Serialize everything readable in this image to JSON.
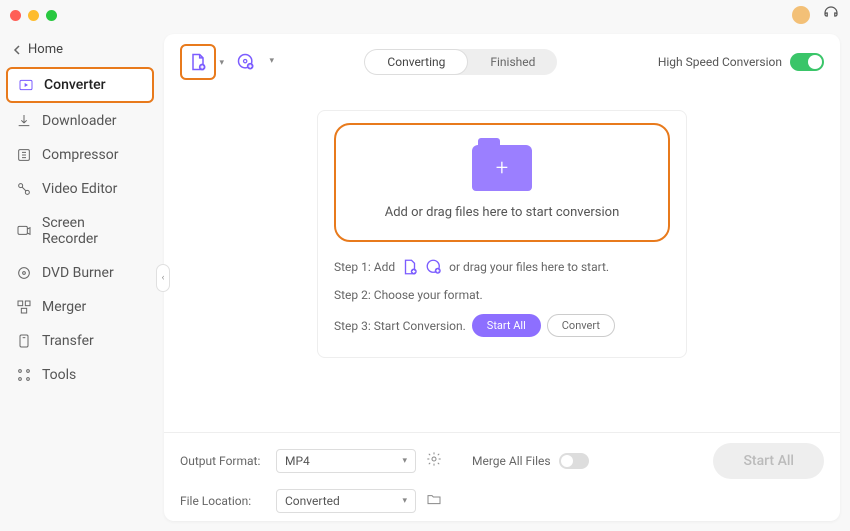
{
  "titlebar": {},
  "sidebar": {
    "home_label": "Home",
    "items": [
      {
        "label": "Converter"
      },
      {
        "label": "Downloader"
      },
      {
        "label": "Compressor"
      },
      {
        "label": "Video Editor"
      },
      {
        "label": "Screen Recorder"
      },
      {
        "label": "DVD Burner"
      },
      {
        "label": "Merger"
      },
      {
        "label": "Transfer"
      },
      {
        "label": "Tools"
      }
    ]
  },
  "toolbar": {
    "tabs": {
      "converting": "Converting",
      "finished": "Finished"
    },
    "high_speed_label": "High Speed Conversion"
  },
  "dropzone": {
    "text": "Add or drag files here to start conversion"
  },
  "steps": {
    "s1a": "Step 1: Add",
    "s1b": "or drag your files here to start.",
    "s2": "Step 2: Choose your format.",
    "s3": "Step 3: Start Conversion.",
    "start_all": "Start  All",
    "convert": "Convert"
  },
  "footer": {
    "output_format_label": "Output Format:",
    "output_format_value": "MP4",
    "file_location_label": "File Location:",
    "file_location_value": "Converted",
    "merge_label": "Merge All Files",
    "start_all_btn": "Start All"
  }
}
